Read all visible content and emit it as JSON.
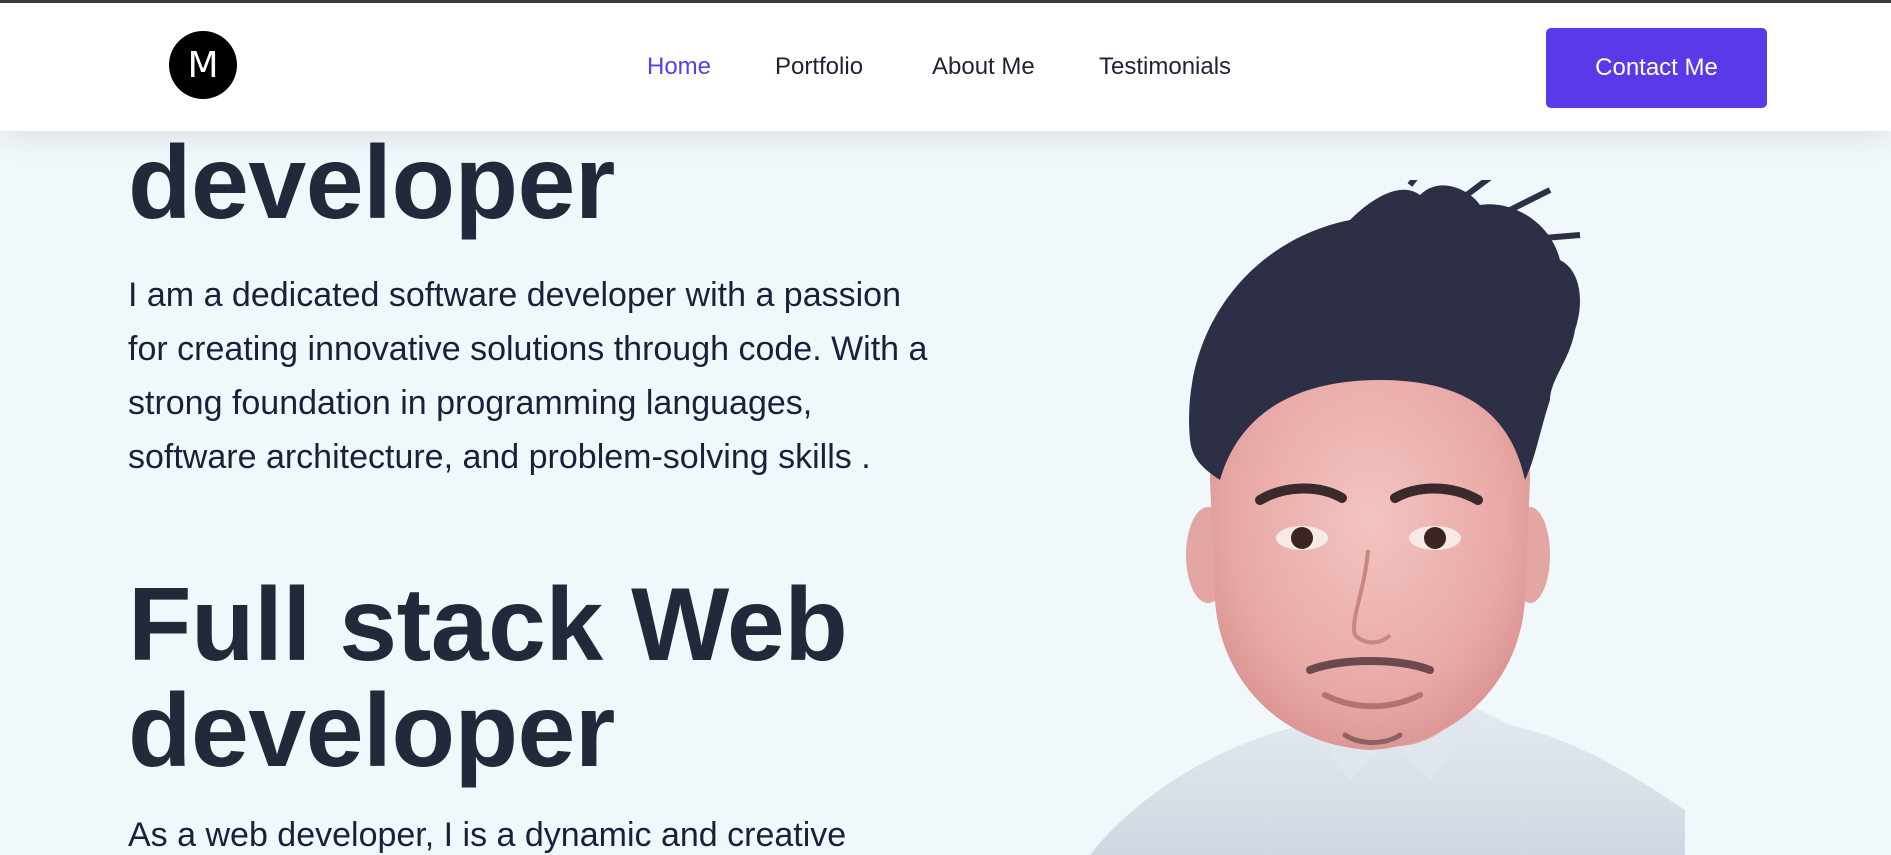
{
  "header": {
    "logo_letter": "M",
    "nav": [
      "Home",
      "Portfolio",
      "About Me",
      "Testimonials"
    ],
    "active_nav": "Home",
    "cta_label": "Contact Me"
  },
  "hero": {
    "partial_heading": "developer",
    "intro": "I am a dedicated software developer with a passion for creating innovative solutions through code. With a strong foundation in programming languages, software architecture, and problem-solving skills .",
    "heading": "Full stack Web developer",
    "web_intro": "As a web developer, I is a dynamic and creative"
  },
  "colors": {
    "accent": "#5a3ae8",
    "text": "#23283a",
    "background": "#f1f8fc"
  }
}
